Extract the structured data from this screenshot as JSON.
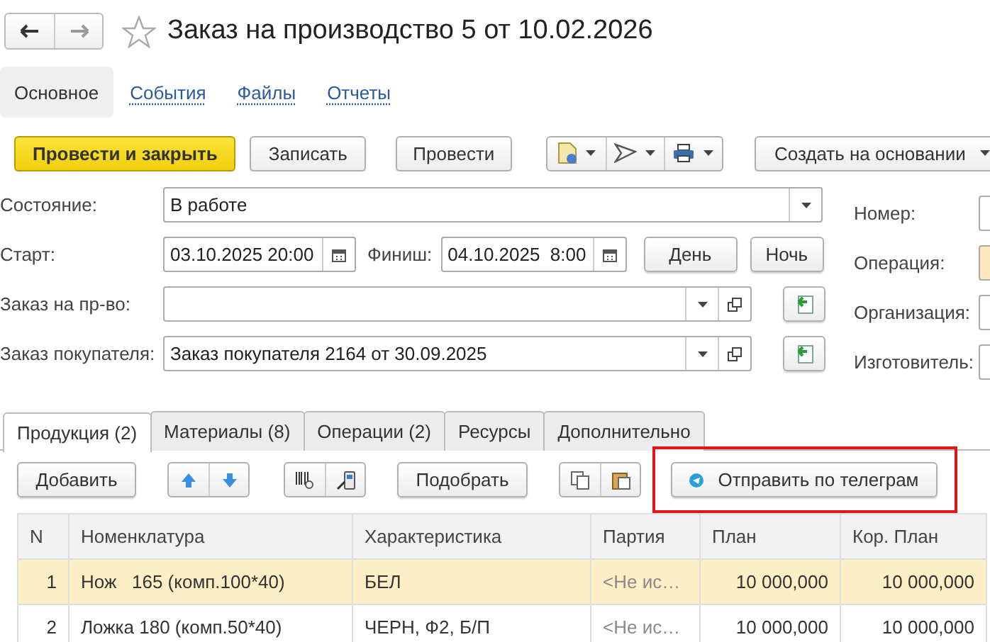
{
  "window": {
    "title": "Заказ на производство 5 от 10.02.2026",
    "favorite": false
  },
  "nav_links": [
    {
      "label": "Основное",
      "selected": true
    },
    {
      "label": "События",
      "selected": false
    },
    {
      "label": "Файлы",
      "selected": false
    },
    {
      "label": "Отчеты",
      "selected": false
    }
  ],
  "toolbar": {
    "buttons": [
      {
        "kind": "default",
        "label": "Провести и закрыть"
      },
      {
        "kind": "plain",
        "label": "Записать"
      },
      {
        "kind": "plain",
        "label": "Провести"
      }
    ],
    "create_menu": "Создать на основании"
  },
  "form": {
    "state": {
      "label": "Состояние:",
      "value": "В работе"
    },
    "start": {
      "label": "Старт:",
      "value": "03.10.2025 20:00"
    },
    "finish": {
      "label": "Финиш:",
      "value": "04.10.2025  8:00"
    },
    "shift_buttons": [
      "День",
      "Ночь"
    ],
    "production_order": {
      "label": "Заказ на пр-во:"
    },
    "customer_order": {
      "label": "Заказ покупателя:",
      "value": "Заказ покупателя 2164 от 30.09.2025"
    },
    "right_fields": [
      {
        "label": "Номер:",
        "kind": "plain"
      },
      {
        "label": "Операция:",
        "kind": "required"
      },
      {
        "label": "Организация:",
        "kind": "plain"
      },
      {
        "label": "Изготовитель:",
        "kind": "plain"
      }
    ]
  },
  "tabs": [
    {
      "label": "Продукция (2)",
      "selected": true
    },
    {
      "label": "Материалы (8)",
      "selected": false
    },
    {
      "label": "Операции (2)",
      "selected": false
    },
    {
      "label": "Ресурсы",
      "selected": false
    },
    {
      "label": "Дополнительно",
      "selected": false
    }
  ],
  "table_toolbar": {
    "add": "Добавить",
    "pick": "Подобрать",
    "telegram": {
      "label": "Отправить по телеграм",
      "highlighted": true
    }
  },
  "table": {
    "columns": [
      "N",
      "Номенклатура",
      "Характеристика",
      "Партия",
      "План",
      "Кор. План"
    ],
    "rows": [
      {
        "selected": true,
        "cells": [
          "1",
          "Нож   165 (комп.100*40)",
          "БЕЛ",
          "<Не ис…",
          "10 000,000",
          "10 000,000"
        ]
      },
      {
        "selected": false,
        "cells": [
          "2",
          "Ложка 180 (комп.50*40)",
          "ЧЕРН, Ф2, Б/П",
          "<Не ис…",
          "10 000,000",
          "10 000,000"
        ]
      }
    ]
  }
}
